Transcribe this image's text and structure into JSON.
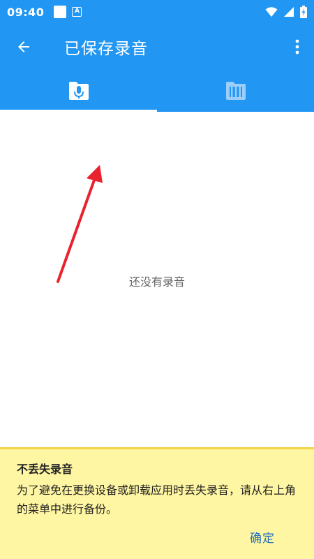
{
  "status_bar": {
    "time": "09:40",
    "notification_icon": "notification-square-icon",
    "a_badge": "A",
    "wifi_icon": "wifi-icon",
    "signal_icon": "signal-icon",
    "battery_icon": "battery-charging-icon"
  },
  "app_bar": {
    "title": "已保存录音",
    "back_icon": "arrow-back-icon",
    "more_icon": "more-vert-icon"
  },
  "tabs": [
    {
      "icon": "microphone-icon",
      "selected": true
    },
    {
      "icon": "piano-icon",
      "selected": false
    }
  ],
  "content": {
    "empty_message": "还没有录音"
  },
  "banner": {
    "title": "不丢失录音",
    "body": "为了避免在更换设备或卸载应用时丢失录音，请从右上角的菜单中进行备份。",
    "ok_label": "确定"
  },
  "colors": {
    "primary": "#2196f3",
    "banner_bg": "#fff6a3",
    "banner_border": "#f1d54a",
    "link": "#1e6fb8",
    "annotation_arrow": "#e8232e"
  }
}
